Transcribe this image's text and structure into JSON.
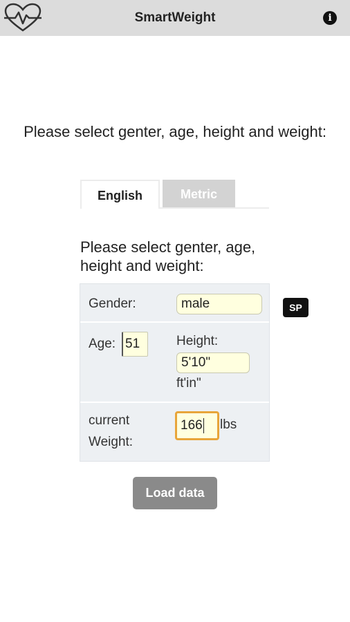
{
  "header": {
    "title": "SmartWeight",
    "logo_icon": "heart-pulse-icon",
    "info_icon": "info-icon",
    "info_glyph": "i",
    "background": "#dcdcdc"
  },
  "prompt": "Please select genter, age, height and weight:",
  "tabs": [
    {
      "label": "English",
      "active": true
    },
    {
      "label": "Metric",
      "active": false
    }
  ],
  "form": {
    "prompt": "Please select genter, age, height and weight:",
    "gender_label": "Gender:",
    "gender_value": "male",
    "age_label": "Age:",
    "age_value": "51",
    "height_label": "Height:",
    "height_value": "5'10\"",
    "height_unit": "ft'in\"",
    "weight_label_line1": "current",
    "weight_label_line2": "Weight:",
    "weight_value": "166",
    "weight_unit": "lbs"
  },
  "sp_badge": "SP",
  "load_button": "Load data",
  "colors": {
    "focus_border": "#e8a53a",
    "input_bg": "#ffffdf",
    "button_bg": "#8a8a8a"
  }
}
